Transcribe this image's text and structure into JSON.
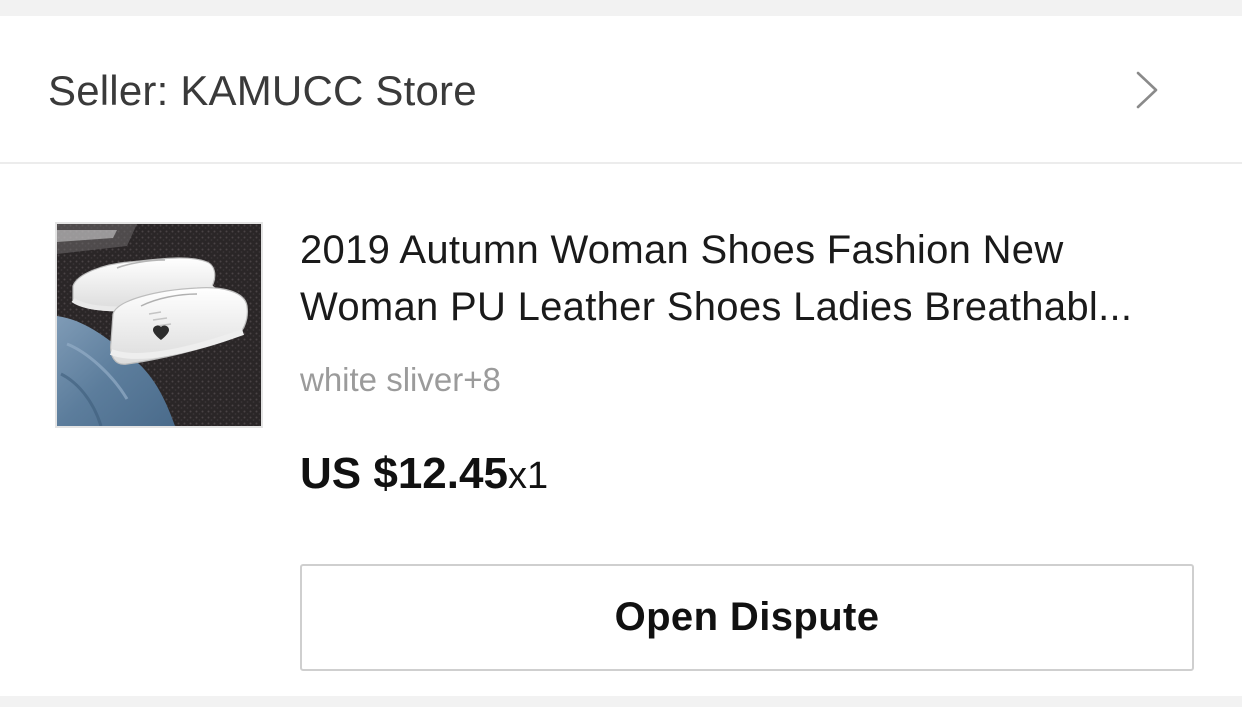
{
  "seller": {
    "label": "Seller: KAMUCC Store",
    "chevron_icon": "chevron-right-icon"
  },
  "product": {
    "title_line1": "2019 Autumn Woman Shoes Fashion New",
    "title_line2": "Woman PU Leather Shoes Ladies Breathabl...",
    "variant": "white sliver+8",
    "price": "US $12.45",
    "quantity": "x1",
    "image_icon": "white-sneakers-product-image"
  },
  "actions": {
    "open_dispute_label": "Open Dispute"
  },
  "colors": {
    "background": "#f2f2f2",
    "card": "#ffffff",
    "text_primary": "#1a1a1a",
    "text_secondary": "#9b9b9b",
    "border": "#cfcfcf"
  }
}
